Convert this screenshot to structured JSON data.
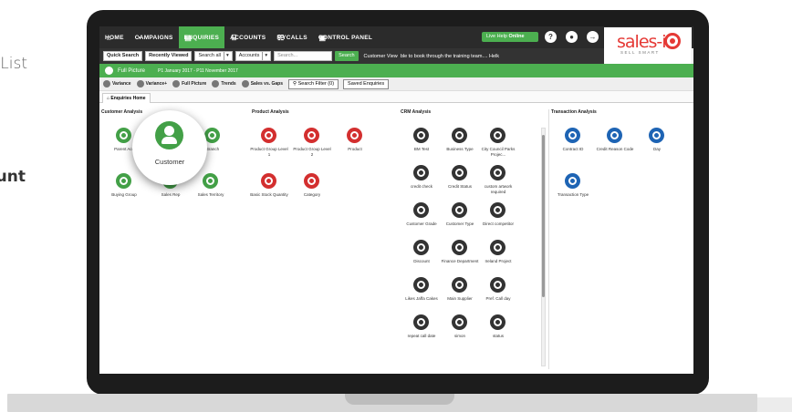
{
  "background": {
    "text_top": "List",
    "text_mid": "Account"
  },
  "nav": {
    "items": [
      {
        "label": "HOME",
        "icon": "home-icon",
        "active": false
      },
      {
        "label": "CAMPAIGNS",
        "icon": "campaigns-icon",
        "active": false
      },
      {
        "label": "ENQUIRIES",
        "icon": "enquiries-icon",
        "active": true
      },
      {
        "label": "ACCOUNTS",
        "icon": "accounts-icon",
        "active": false
      },
      {
        "label": "MYCALLS",
        "icon": "mycalls-icon",
        "active": false
      },
      {
        "label": "CONTROL PANEL",
        "icon": "control-panel-icon",
        "active": false
      }
    ],
    "live_help": "Live Help",
    "live_help_status": "Online",
    "help_icon": "?",
    "logo_text": "sales-i",
    "logo_tagline": "SELL SMART"
  },
  "search": {
    "quick_search": "Quick Search",
    "recently_viewed": "Recently Viewed",
    "scope": "Search all",
    "category": "Accounts",
    "placeholder": "Search...",
    "go": "Search",
    "customer_view_label": "Customer View",
    "ticker": "ble to book through the training team.... Helk"
  },
  "period": {
    "title": "Full Picture",
    "range": "P1 January 2017 - P11 November 2017"
  },
  "toolbar": {
    "variance": "Variance",
    "variance_plus": "Variance+",
    "full_picture": "Full Picture",
    "trends": "Trends",
    "sales_vs_gaps": "Sales vs. Gaps",
    "search_filter": "Search Filter (0)",
    "saved_enquiries": "Saved Enquiries"
  },
  "tab": {
    "label": "Enquiries Home"
  },
  "sections": {
    "customer": {
      "title": "Customer Analysis",
      "items": [
        "Parent Acc",
        "Customer",
        "Branch",
        "Buying Group",
        "Sales Rep",
        "Sales Territory"
      ]
    },
    "product": {
      "title": "Product Analysis",
      "items": [
        "Product Group Level 1",
        "Product Group Level 2",
        "Product",
        "Basic Stock Quantity",
        "Category"
      ]
    },
    "crm": {
      "title": "CRM Analysis",
      "items": [
        "BM Test",
        "Business Type",
        "City Council Parks Projec...",
        "credit check",
        "Credit Status",
        "custom artwork required",
        "Customer Grade",
        "Customer Type",
        "Direct competitor",
        "Discount",
        "Finance Department",
        "Ireland Project",
        "Likes Jaffa Cakes",
        "Main Supplier",
        "Pref. Call day",
        "repeat call date",
        "simon",
        "status"
      ]
    },
    "transaction": {
      "title": "Transaction Analysis",
      "items": [
        "Contract ID",
        "Credit Reason Code",
        "Day",
        "Transaction Type"
      ]
    }
  },
  "product_badges": [
    "1",
    "2"
  ],
  "tooltip": {
    "label": "Customer"
  }
}
